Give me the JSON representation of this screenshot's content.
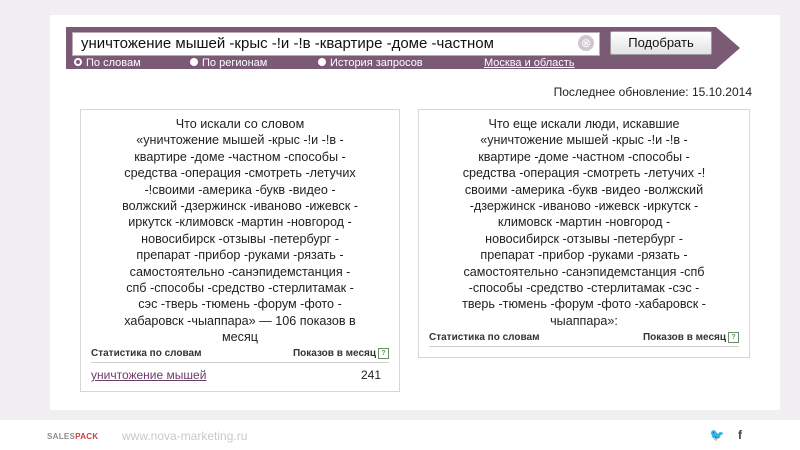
{
  "search": {
    "query": "уничтожение мышей   -крыс -!и -!в -квартире -доме -частном",
    "clear_symbol": "⊗",
    "submit_label": "Подобрать"
  },
  "radio_options": [
    {
      "label": "По словам",
      "selected": true
    },
    {
      "label": "По регионам",
      "selected": false
    },
    {
      "label": "История запросов",
      "selected": false
    }
  ],
  "region_link": "Москва и область",
  "last_updated": "Последнее обновление: 15.10.2014",
  "left_panel": {
    "lines": [
      "Что искали со словом",
      "«уничтожение мышей -крыс -!и -!в -",
      "квартире -доме -частном -способы -",
      "средства -операция -смотреть -летучих",
      "-!своими -америка -букв -видео -",
      "волжский -дзержинск -иваново -ижевск -",
      "иркутск -климовск -мартин -новгород -",
      "новосибирск -отзывы -петербург -",
      "препарат -прибор -руками -рязать -",
      "самостоятельно -санэпидемстанция -",
      "спб -способы -средство -стерлитамак -",
      "сэс -тверь -тюмень -форум -фото -",
      "хабаровск -чыаппара» — 106 показов в",
      "месяц"
    ],
    "stats_header_left": "Статистика по словам",
    "stats_header_right": "Показов в месяц",
    "rows": [
      {
        "keyword": "уничтожение мышей",
        "count": "241"
      }
    ]
  },
  "right_panel": {
    "lines": [
      "Что еще искали люди, искавшие",
      "«уничтожение мышей -крыс -!и -!в -",
      "квартире -доме -частном -способы -",
      "средства -операция -смотреть -летучих -!",
      "своими -америка -букв -видео -волжский",
      "-дзержинск -иваново -ижевск -иркутск -",
      "климовск -мартин -новгород -",
      "новосибирск -отзывы -петербург -",
      "препарат -прибор -руками -рязать -",
      "самостоятельно -санэпидемстанция -спб",
      "-способы -средство -стерлитамак -сэс -",
      "тверь -тюмень -форум -фото -хабаровск -",
      "чыаппара»:"
    ],
    "stats_header_left": "Статистика по словам",
    "stats_header_right": "Показов в месяц"
  },
  "help_symbol": "?",
  "footer": {
    "brand_part1": "SALES",
    "brand_part2": "PACK",
    "site": "www.nova-marketing.ru",
    "twitter_icon": "twitter-icon",
    "facebook_icon": "facebook-icon",
    "twitter_glyph": "🐦",
    "facebook_glyph": "f"
  },
  "colors": {
    "band": "#7b5a75",
    "brand_accent": "#d23b3b",
    "link": "#6a3d6a"
  }
}
